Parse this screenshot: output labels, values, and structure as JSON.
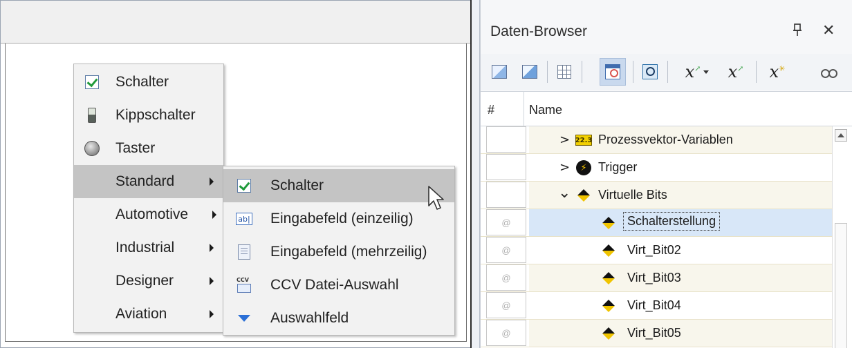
{
  "main_menu": {
    "items": [
      {
        "label": "Schalter",
        "icon": "checkbox-icon"
      },
      {
        "label": "Kippschalter",
        "icon": "toggle-switch-icon"
      },
      {
        "label": "Taster",
        "icon": "push-button-icon"
      },
      {
        "label": "Standard",
        "submenu": true,
        "highlighted": true
      },
      {
        "label": "Automotive",
        "submenu": true
      },
      {
        "label": "Industrial",
        "submenu": true
      },
      {
        "label": "Designer",
        "submenu": true
      },
      {
        "label": "Aviation",
        "submenu": true
      }
    ]
  },
  "sub_menu": {
    "items": [
      {
        "label": "Schalter",
        "icon": "checkbox-icon",
        "highlighted": true
      },
      {
        "label": "Eingabefeld (einzeilig)",
        "icon": "text-field-icon",
        "icon_text": "ab|"
      },
      {
        "label": "Eingabefeld (mehrzeilig)",
        "icon": "multiline-field-icon"
      },
      {
        "label": "CCV Datei-Auswahl",
        "icon": "ccv-file-icon",
        "icon_text": "CCV"
      },
      {
        "label": "Auswahlfeld",
        "icon": "dropdown-icon"
      }
    ]
  },
  "browser": {
    "title": "Daten-Browser",
    "pin_icon": "pin-icon",
    "close_label": "✕",
    "toolbar": [
      "chart-icon",
      "chart-alt-icon",
      "grid-icon",
      "properties-icon",
      "zoom-icon",
      "formula-icon",
      "formula-edit-icon",
      "formula-new-icon",
      "binoculars-icon"
    ],
    "table": {
      "columns": [
        "#",
        "Name"
      ],
      "rows": [
        {
          "index": "",
          "label": "Prozessvektor-Variablen",
          "icon": "process-vector-icon",
          "icon_text": "22.3",
          "expander": ">",
          "level": 1
        },
        {
          "index": "",
          "label": "Trigger",
          "icon": "trigger-icon",
          "icon_text": "⚡",
          "expander": ">",
          "level": 1
        },
        {
          "index": "",
          "label": "Virtuelle Bits",
          "icon": "virtual-bit-icon",
          "expander": "⌄",
          "level": 1
        },
        {
          "index": "@",
          "label": "Schalterstellung",
          "icon": "virtual-bit-icon",
          "level": 2,
          "selected": true
        },
        {
          "index": "@",
          "label": "Virt_Bit02",
          "icon": "virtual-bit-icon",
          "level": 2
        },
        {
          "index": "@",
          "label": "Virt_Bit03",
          "icon": "virtual-bit-icon",
          "level": 2
        },
        {
          "index": "@",
          "label": "Virt_Bit04",
          "icon": "virtual-bit-icon",
          "level": 2
        },
        {
          "index": "@",
          "label": "Virt_Bit05",
          "icon": "virtual-bit-icon",
          "level": 2
        }
      ]
    }
  },
  "colors": {
    "menu_background": "#f2f2f2",
    "menu_highlight": "#c4c4c4",
    "selection": "#d8e7f8",
    "row_tint": "#f8f6ec"
  }
}
